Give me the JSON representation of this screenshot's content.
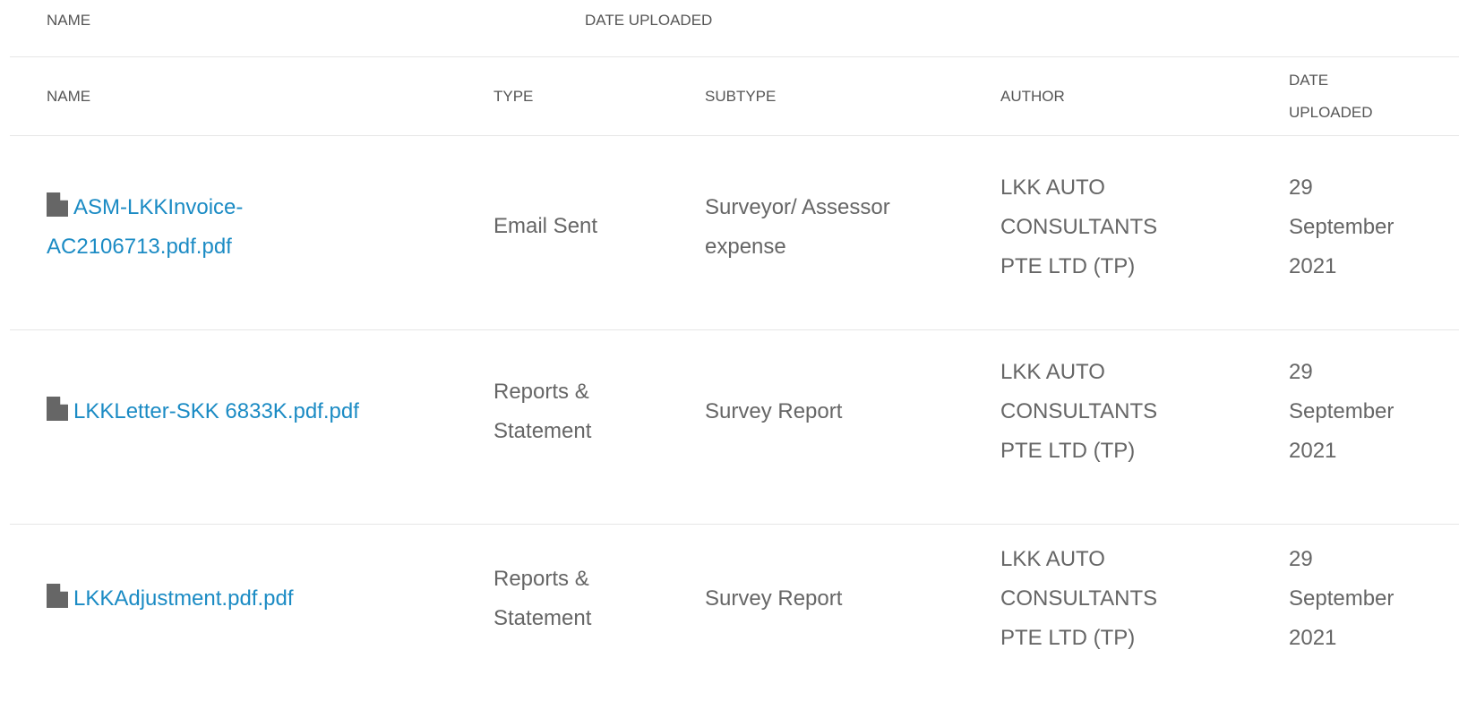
{
  "top_header": {
    "name_label": "NAME",
    "date_label": "DATE UPLOADED"
  },
  "table": {
    "columns": {
      "name": "NAME",
      "type": "TYPE",
      "subtype": "SUBTYPE",
      "author": "AUTHOR",
      "date_line1": "DATE",
      "date_line2": "UPLOADED"
    },
    "rows": [
      {
        "name_line1": "ASM-LKKInvoice-",
        "name_line2": "AC2106713.pdf.pdf",
        "type_line1": "Email Sent",
        "type_line2": "",
        "subtype_line1": "Surveyor/ Assessor",
        "subtype_line2": "expense",
        "author_line1": "LKK AUTO",
        "author_line2": "CONSULTANTS",
        "author_line3": "PTE LTD (TP)",
        "date_line1": "29",
        "date_line2": "September",
        "date_line3": "2021"
      },
      {
        "name_line1": "LKKLetter-SKK 6833K.pdf.pdf",
        "name_line2": "",
        "type_line1": "Reports &",
        "type_line2": "Statement",
        "subtype_line1": "Survey Report",
        "subtype_line2": "",
        "author_line1": "LKK AUTO",
        "author_line2": "CONSULTANTS",
        "author_line3": "PTE LTD (TP)",
        "date_line1": "29",
        "date_line2": "September",
        "date_line3": "2021"
      },
      {
        "name_line1": "LKKAdjustment.pdf.pdf",
        "name_line2": "",
        "type_line1": "Reports &",
        "type_line2": "Statement",
        "subtype_line1": "Survey Report",
        "subtype_line2": "",
        "author_line1": "LKK AUTO",
        "author_line2": "CONSULTANTS",
        "author_line3": "PTE LTD (TP)",
        "date_line1": "29",
        "date_line2": "September",
        "date_line3": "2021"
      }
    ]
  },
  "colors": {
    "link": "#1b8bc4",
    "text": "#666666",
    "header_text": "#555555",
    "divider": "#e6e6e6",
    "icon": "#666666"
  },
  "icons": {
    "file": "file-icon"
  }
}
